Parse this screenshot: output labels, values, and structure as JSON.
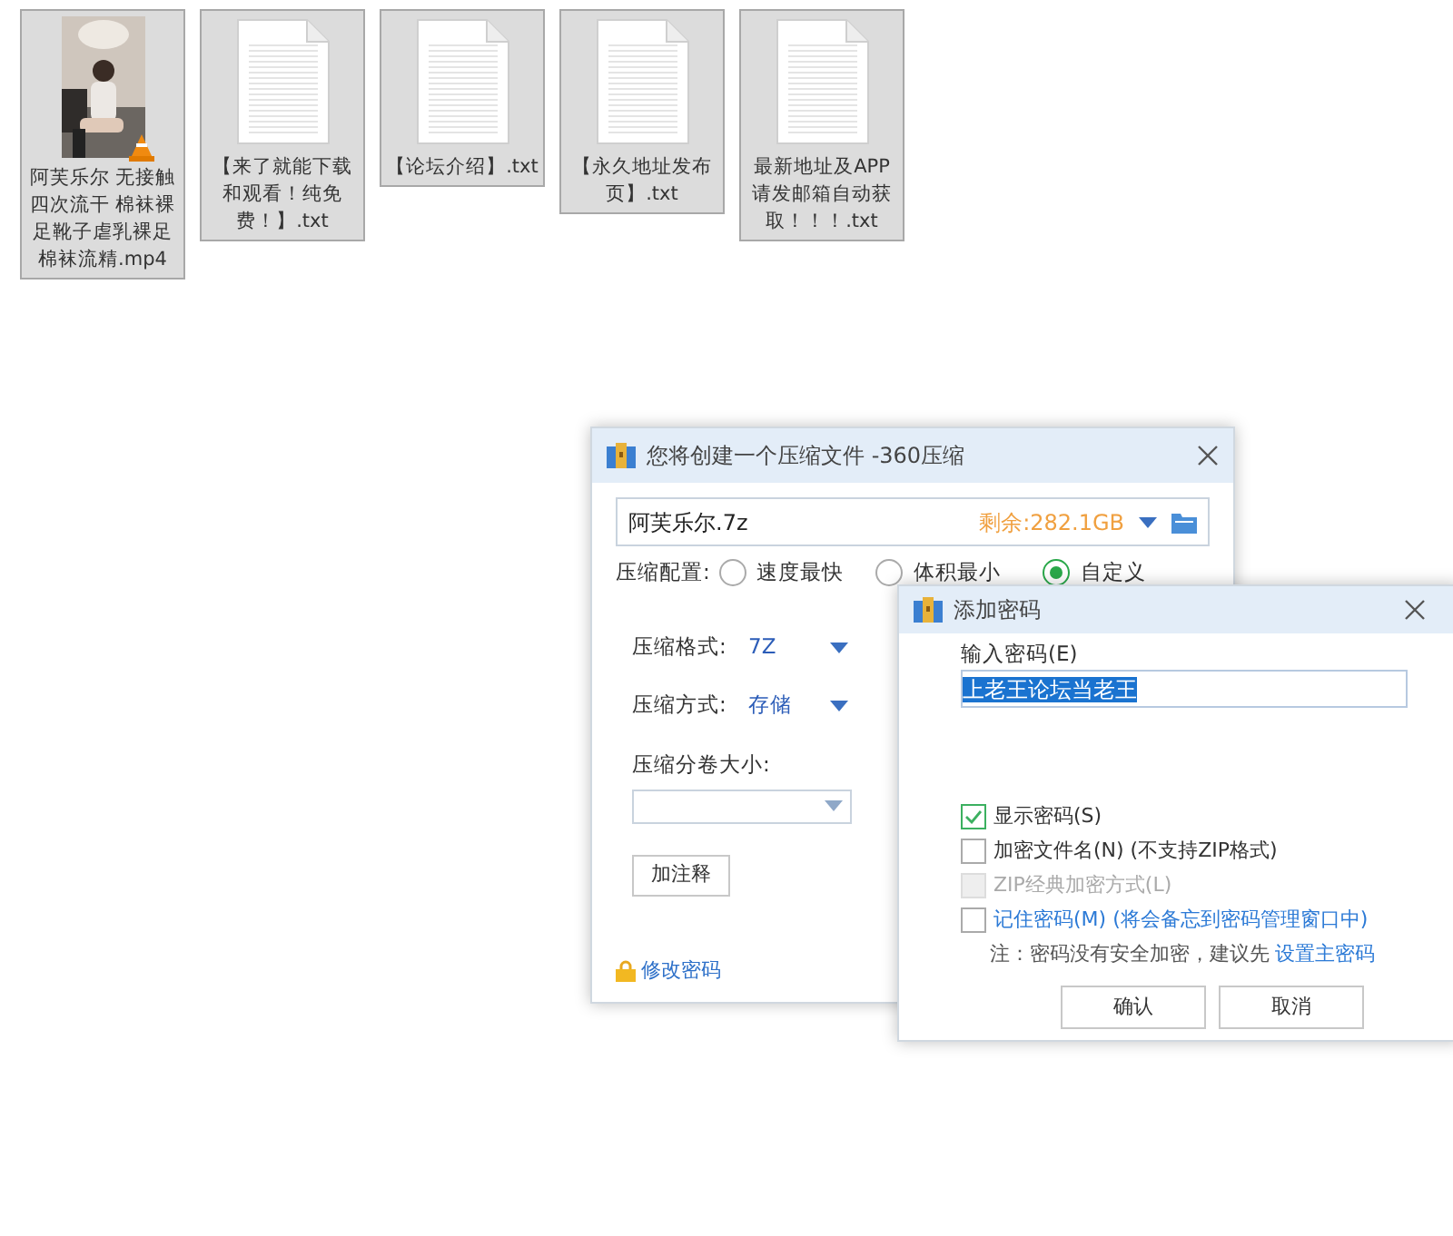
{
  "files": [
    {
      "name": "阿芙乐尔 无接触四次流干 棉袜裸足靴子虐乳裸足棉袜流精.mp4",
      "kind": "video"
    },
    {
      "name": "【来了就能下载和观看！纯免费！】.txt",
      "kind": "text"
    },
    {
      "name": "【论坛介绍】.txt",
      "kind": "text"
    },
    {
      "name": "【永久地址发布页】.txt",
      "kind": "text"
    },
    {
      "name": "最新地址及APP请发邮箱自动获取！！！.txt",
      "kind": "text"
    }
  ],
  "compress_dialog": {
    "title": "您将创建一个压缩文件 -360压缩",
    "file_name": "阿芙乐尔.7z",
    "free_space": "剩余:282.1GB",
    "config_label": "压缩配置:",
    "radios": [
      {
        "label": "速度最快",
        "selected": false
      },
      {
        "label": "体积最小",
        "selected": false
      },
      {
        "label": "自定义",
        "selected": true
      }
    ],
    "format_label": "压缩格式:",
    "format": "7Z",
    "method_label": "压缩方式:",
    "method": "存储",
    "volume_label": "压缩分卷大小:",
    "comment_button": "加注释",
    "change_password": "修改密码"
  },
  "password_dialog": {
    "title": "添加密码",
    "input_label": "输入密码(E)",
    "password": "上老王论坛当老王",
    "options": [
      {
        "label": "显示密码(S)",
        "checked": true,
        "disabled": false,
        "link": false
      },
      {
        "label": "加密文件名(N) (不支持ZIP格式)",
        "checked": false,
        "disabled": false,
        "link": false
      },
      {
        "label": "ZIP经典加密方式(L)",
        "checked": false,
        "disabled": true,
        "link": false
      },
      {
        "label": "记住密码(M) (将会备忘到密码管理窗口中)",
        "checked": false,
        "disabled": false,
        "link": true
      }
    ],
    "note": "注：密码没有安全加密，建议先",
    "note_link": "设置主密码",
    "buttons": [
      "确认",
      "取消"
    ]
  }
}
